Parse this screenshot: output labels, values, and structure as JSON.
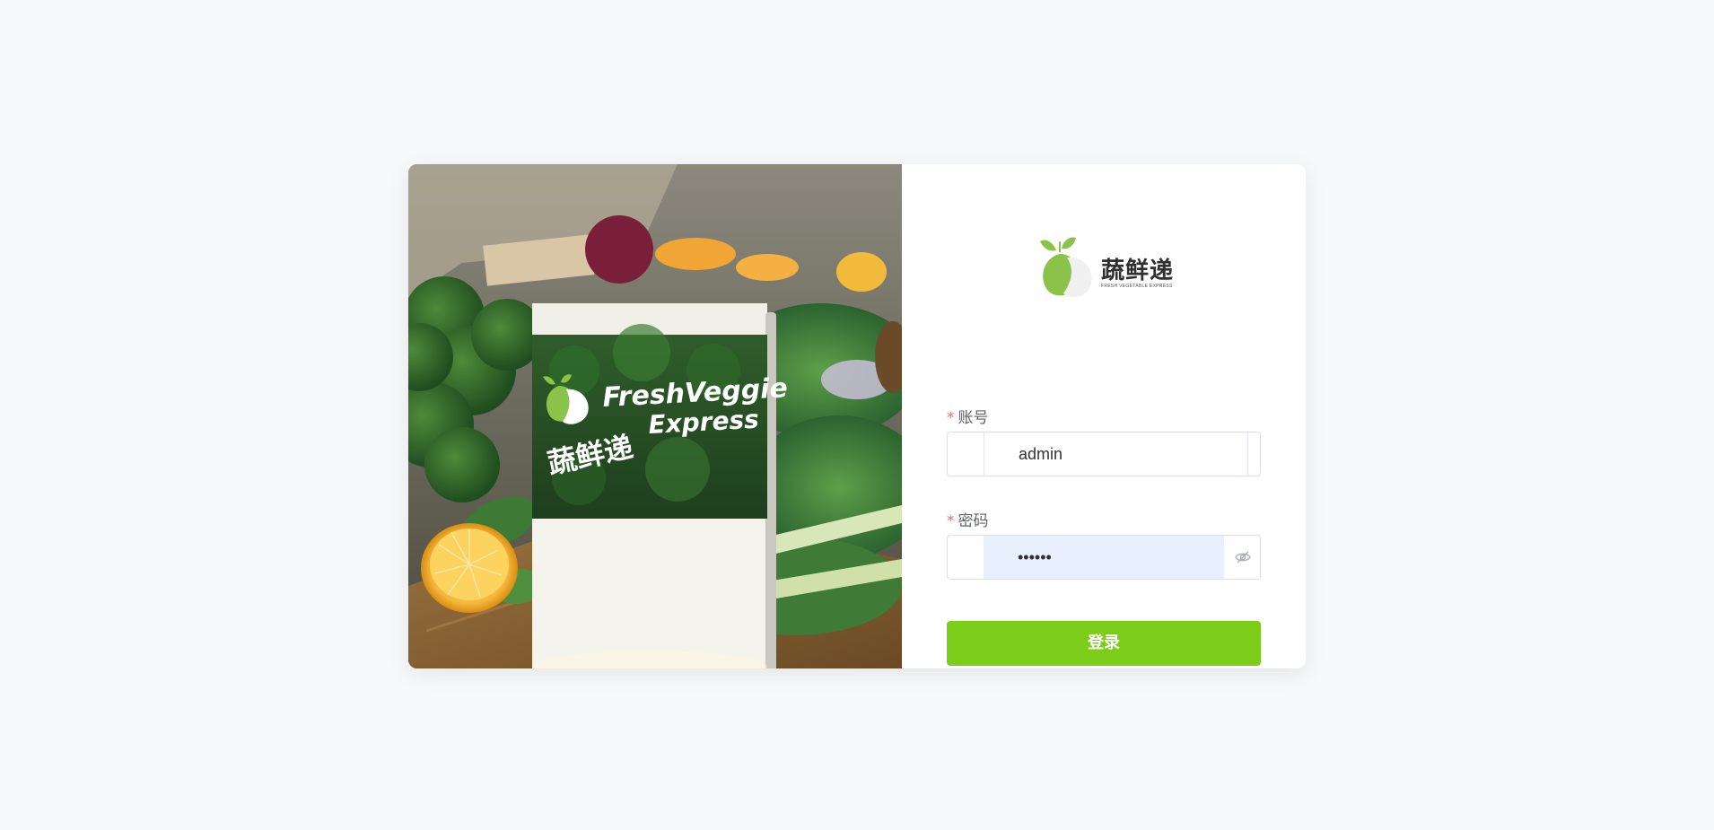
{
  "brand": {
    "name": "蔬鲜递",
    "tagline": "FRESH VEGETABLE EXPRESS",
    "color": "#8bc34a"
  },
  "hero": {
    "package_en_line1": "FreshVeggie",
    "package_en_line2": "Express",
    "package_cn": "蔬鲜递"
  },
  "form": {
    "account_label": "账号",
    "account_value": "admin",
    "password_label": "密码",
    "password_value": "••••••",
    "required_mark": "*",
    "submit_label": "登录",
    "accent_color": "#7ccd19",
    "required_color": "#f56c6c"
  }
}
